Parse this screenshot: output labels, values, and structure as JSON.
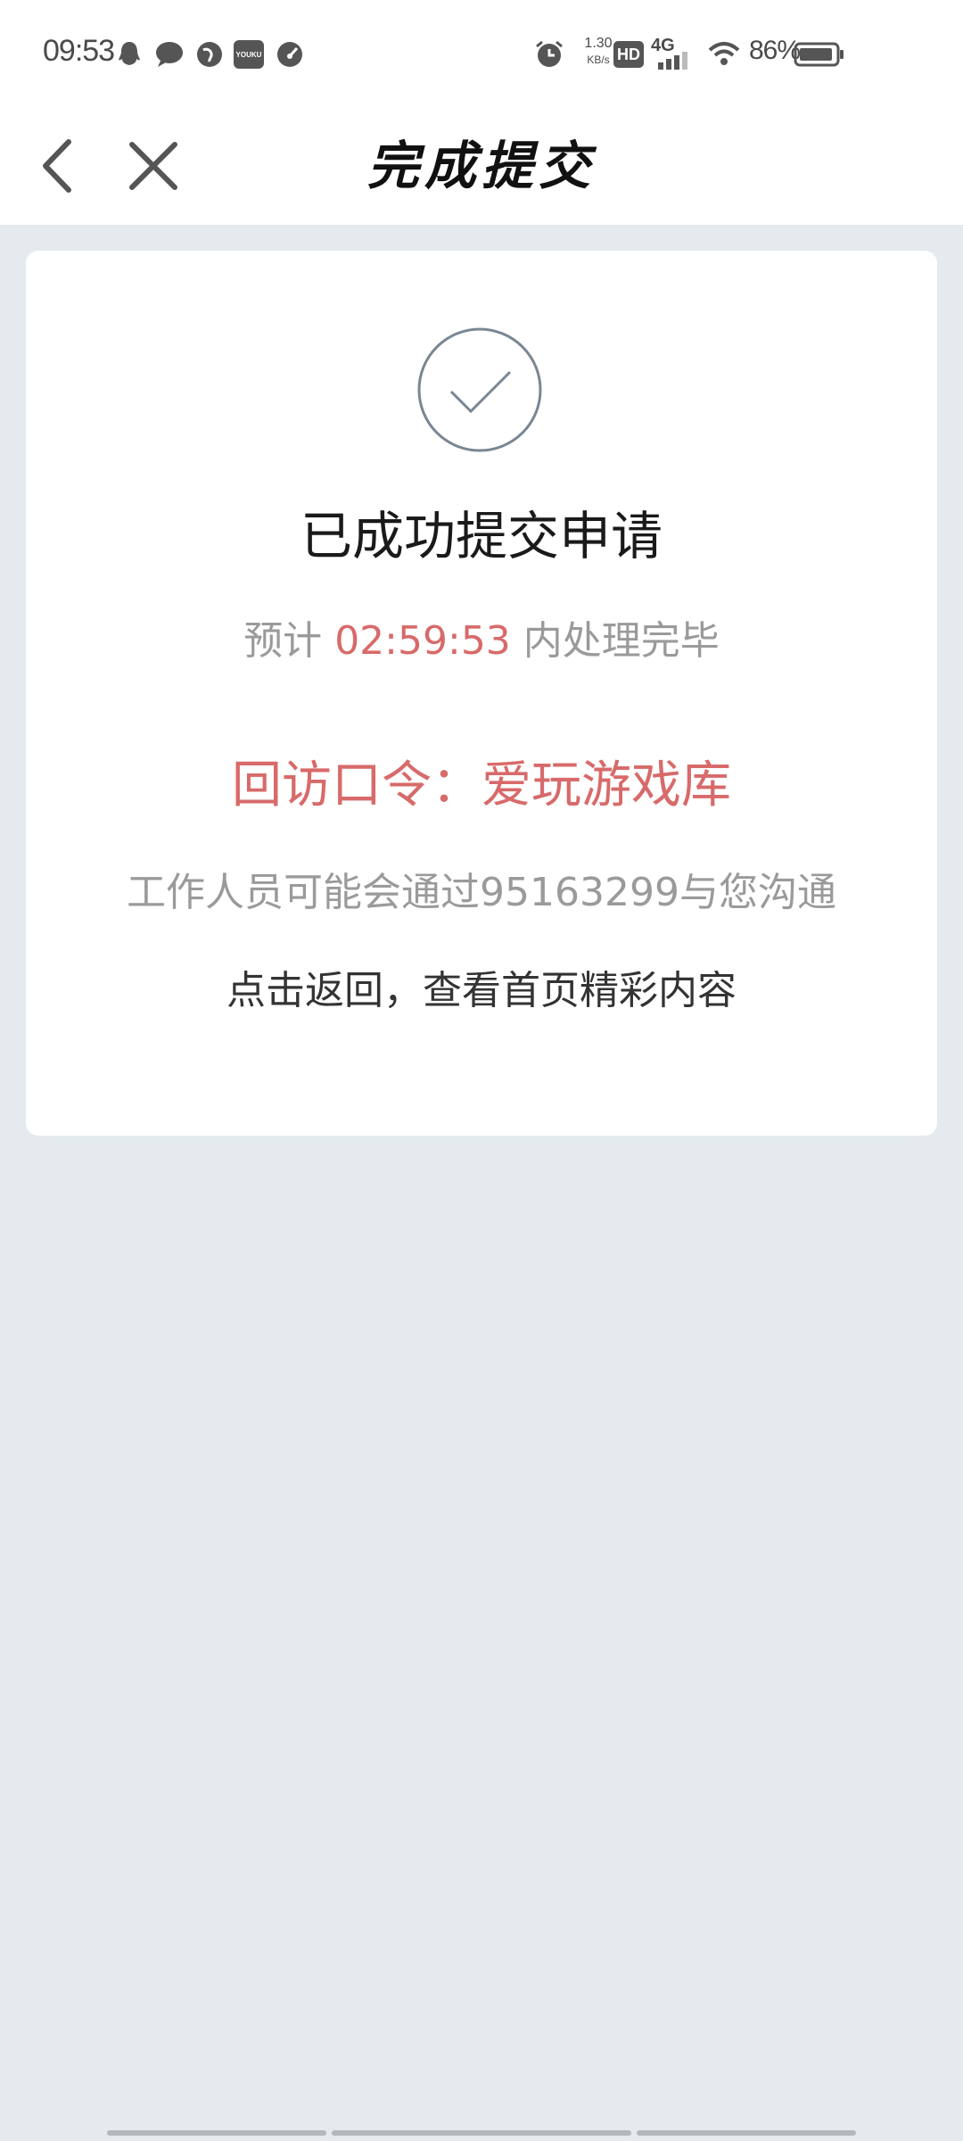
{
  "status_bar": {
    "time": "09:53",
    "net_speed_value": "1.30",
    "net_speed_unit": "KB/s",
    "hd_label": "HD",
    "network_label": "4G",
    "battery_text": "86%",
    "notification_icons": [
      "qq-icon",
      "message-icon",
      "browser-icon",
      "youku-icon",
      "speedometer-icon"
    ],
    "youku_label": "YOUKU"
  },
  "nav": {
    "title": "完成提交"
  },
  "card": {
    "headline": "已成功提交申请",
    "eta_prefix": "预计 ",
    "eta_countdown": "02:59:53",
    "eta_suffix": " 内处理完毕",
    "passcode": "回访口令：爱玩游戏库",
    "contact_line": "工作人员可能会通过95163299与您沟通",
    "back_link": "点击返回，查看首页精彩内容"
  },
  "colors": {
    "accent_red": "#d86a6a",
    "page_bg": "#e4eaee",
    "muted_text": "#9a9a9a",
    "check_stroke": "#7a8693"
  }
}
